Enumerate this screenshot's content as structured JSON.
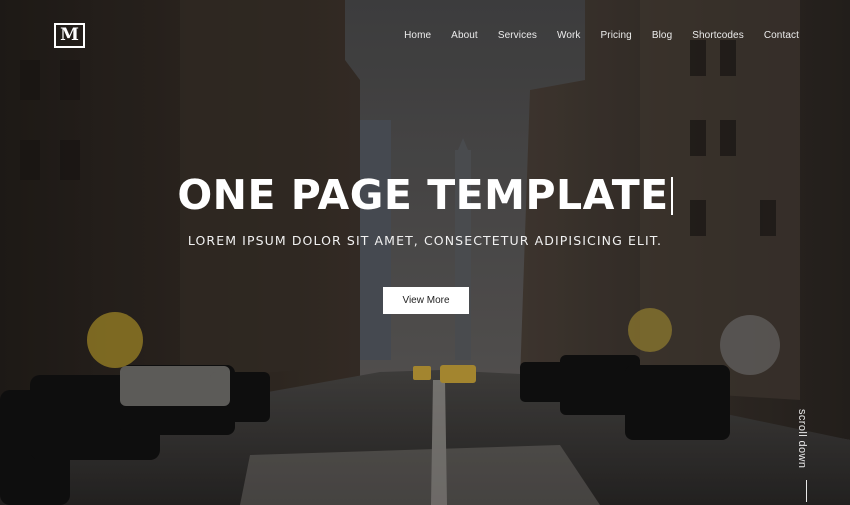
{
  "logo": {
    "text": "M"
  },
  "nav": {
    "items": [
      "Home",
      "About",
      "Services",
      "Work",
      "Pricing",
      "Blog",
      "Shortcodes",
      "Contact"
    ]
  },
  "hero": {
    "title": "ONE PAGE TEMPLATE",
    "subtitle": "LOREM IPSUM DOLOR SIT AMET, CONSECTETUR ADIPISICING ELIT.",
    "button_label": "View More"
  },
  "scroll": {
    "label": "scroll down"
  },
  "colors": {
    "text": "#ffffff",
    "button_bg": "#ffffff",
    "button_text": "#222222"
  },
  "icons": {
    "scroll_indicator": "vertical-line"
  }
}
